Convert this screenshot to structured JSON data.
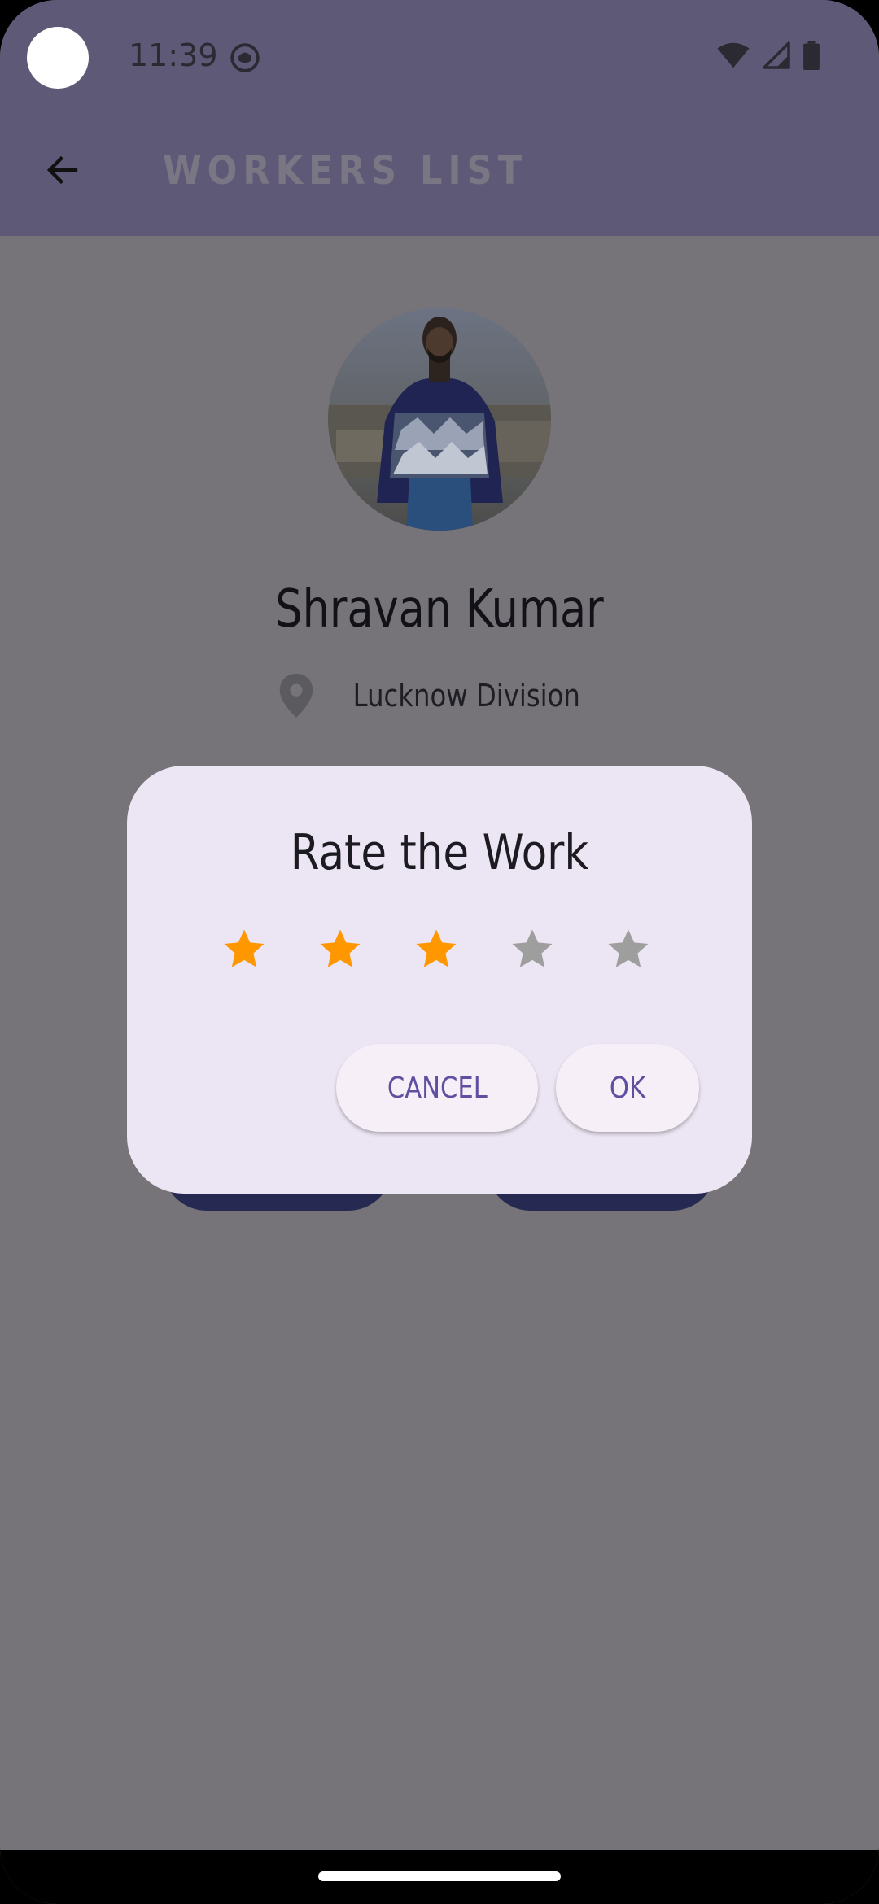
{
  "status_bar": {
    "time": "11:39"
  },
  "app_bar": {
    "title": "WORKERS LIST"
  },
  "profile": {
    "name": "Shravan Kumar",
    "location": "Lucknow Division"
  },
  "dialog": {
    "title": "Rate the Work",
    "rating": 3,
    "max_rating": 5,
    "cancel_label": "CANCEL",
    "ok_label": "OK"
  },
  "colors": {
    "app_bar": "#5e5977",
    "scrim_background": "#767478",
    "dialog_background": "#ece5f3",
    "star_filled": "#ff9800",
    "star_empty": "#9e9e9e",
    "button_text": "#5f4fa0"
  }
}
